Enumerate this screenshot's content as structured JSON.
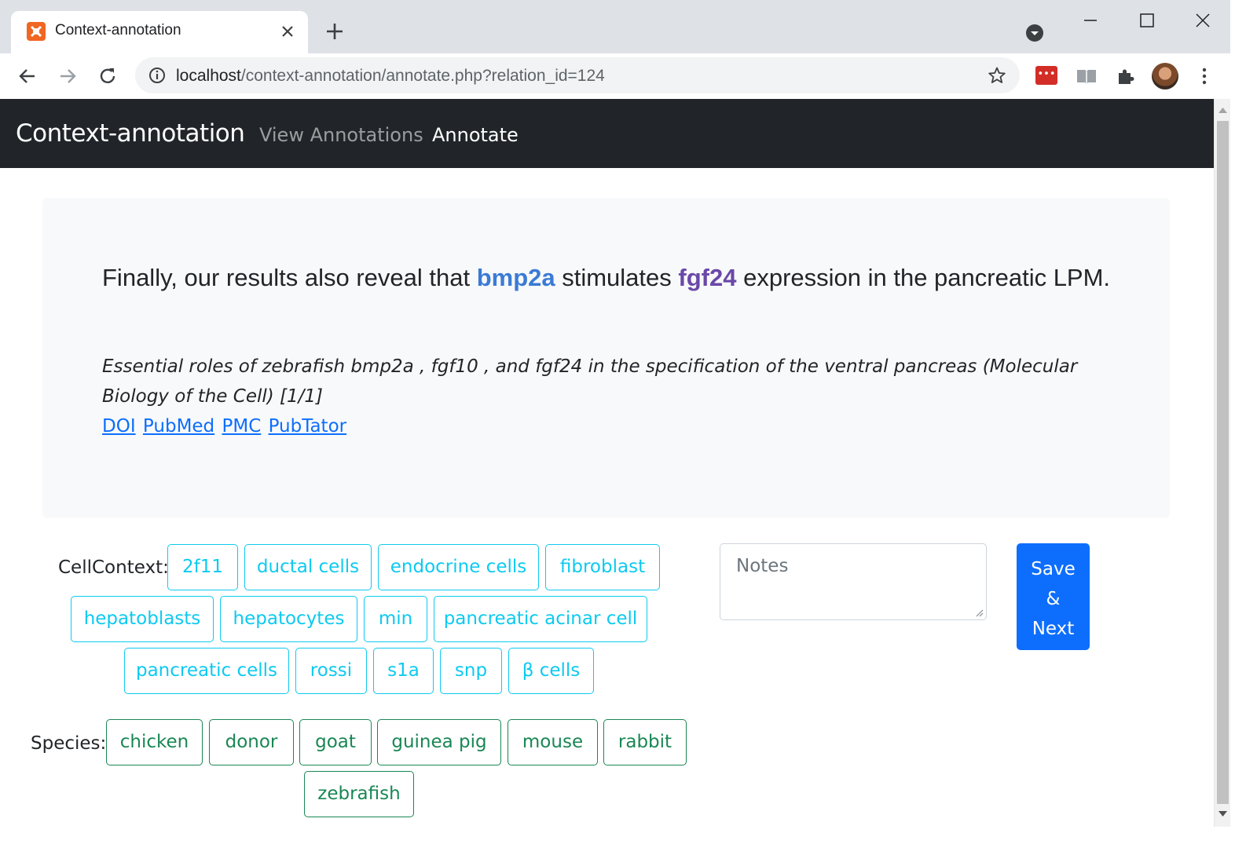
{
  "browser": {
    "tab_title": "Context-annotation",
    "url_host": "localhost",
    "url_path": "/context-annotation/annotate.php?relation_id=124",
    "lastpass_label": "•••"
  },
  "navbar": {
    "brand": "Context-annotation",
    "links": [
      {
        "label": "View Annotations"
      },
      {
        "label": "Annotate"
      }
    ]
  },
  "sentence": {
    "before": "Finally, our results also reveal that ",
    "gene_a": "bmp2a",
    "middle": " stimulates ",
    "gene_b": "fgf24",
    "after": " expression in the pancreatic LPM."
  },
  "paper": {
    "title": "Essential roles of zebrafish bmp2a , fgf10 , and fgf24 in the specification of the ventral pancreas (Molecular Biology of the Cell) [1/1]",
    "links": [
      "DOI",
      "PubMed",
      "PMC",
      "PubTator"
    ]
  },
  "cell_context": {
    "label": "CellContext:",
    "tags": [
      "2f11",
      "ductal cells",
      "endocrine cells",
      "fibroblast",
      "hepatoblasts",
      "hepatocytes",
      "min",
      "pancreatic acinar cell",
      "pancreatic cells",
      "rossi",
      "s1a",
      "snp",
      "β cells"
    ]
  },
  "species": {
    "label": "Species:",
    "tags": [
      "chicken",
      "donor",
      "goat",
      "guinea pig",
      "mouse",
      "rabbit",
      "zebrafish"
    ]
  },
  "notes": {
    "placeholder": "Notes"
  },
  "save_button": {
    "lines": [
      "Save",
      "&",
      "Next"
    ]
  },
  "colors": {
    "navbar_bg": "#212529",
    "gene_a": "#3a7bd5",
    "gene_b": "#6a48a8",
    "cell_tag": "#0dcaf0",
    "species_tag": "#198754",
    "primary": "#0d6efd"
  }
}
